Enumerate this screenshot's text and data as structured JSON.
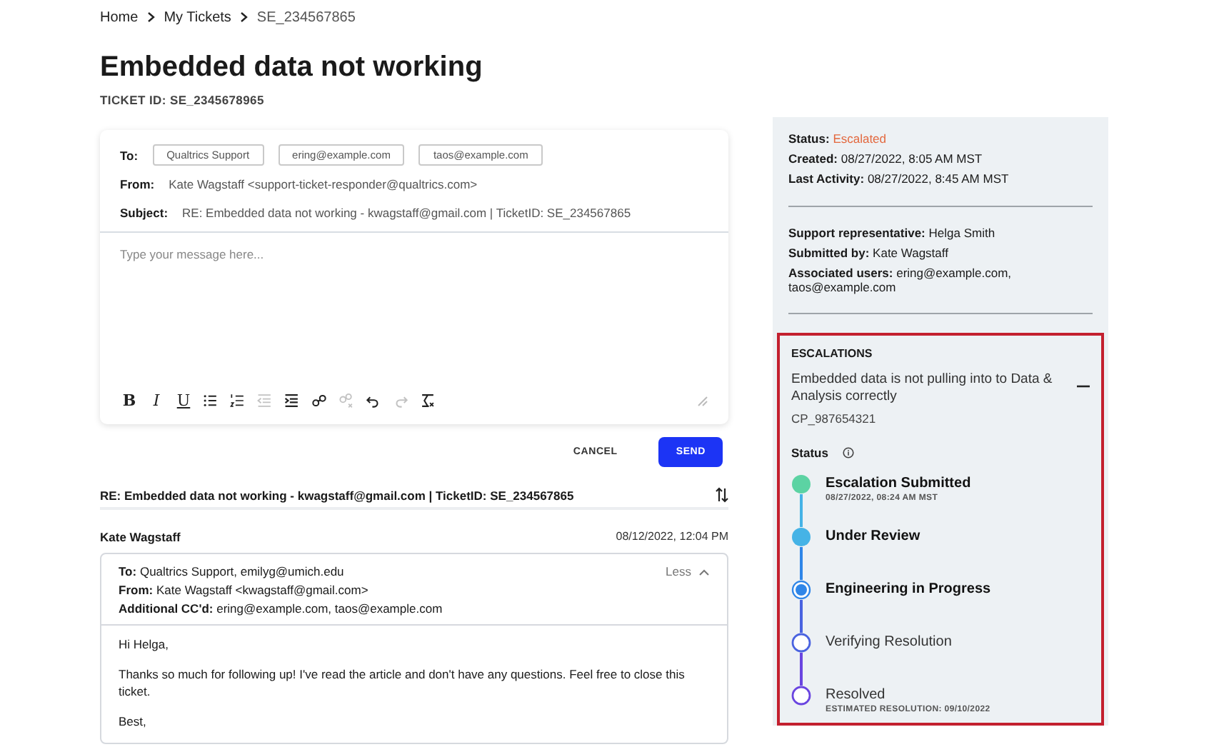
{
  "breadcrumb": [
    {
      "label": "Home",
      "kind": "link"
    },
    {
      "label": "My Tickets",
      "kind": "link"
    },
    {
      "label": "SE_234567865",
      "kind": "current"
    }
  ],
  "title": "Embedded data not working",
  "ticket_id": "TICKET ID: SE_2345678965",
  "compose": {
    "to_label": "To:",
    "recipients": [
      "Qualtrics Support",
      "ering@example.com",
      "taos@example.com"
    ],
    "from_label": "From:",
    "from": "Kate Wagstaff <support-ticket-responder@qualtrics.com>",
    "subject_label": "Subject:",
    "subject": "RE: Embedded data not working - kwagstaff@gmail.com | TicketID: SE_234567865",
    "placeholder": "Type your message here...",
    "tools": [
      {
        "kind": "bold",
        "glyph": "B",
        "disabled": false
      },
      {
        "kind": "italic",
        "glyph": "I",
        "disabled": false
      },
      {
        "kind": "underline",
        "glyph": "U",
        "disabled": false
      },
      {
        "kind": "bullets",
        "disabled": false
      },
      {
        "kind": "numbers",
        "disabled": false
      },
      {
        "kind": "outdent",
        "disabled": true
      },
      {
        "kind": "indent",
        "disabled": false
      },
      {
        "kind": "link",
        "disabled": false
      },
      {
        "kind": "unlink",
        "disabled": true
      },
      {
        "kind": "undo",
        "disabled": false
      },
      {
        "kind": "redo",
        "disabled": true
      },
      {
        "kind": "clear",
        "disabled": false
      }
    ]
  },
  "actions": [
    {
      "label": "CANCEL",
      "kind": "secondary"
    },
    {
      "label": "SEND",
      "kind": "primary"
    }
  ],
  "thread": {
    "subject": "RE: Embedded data not working - kwagstaff@gmail.com | TicketID: SE_234567865",
    "message": {
      "author": "Kate Wagstaff",
      "date": "08/12/2022, 12:04 PM",
      "toggle": "Less",
      "expanded": true,
      "headers": [
        {
          "label": "To:",
          "value": "Qualtrics Support, emilyg@umich.edu"
        },
        {
          "label": "From:",
          "value": "Kate Wagstaff <kwagstaff@gmail.com>"
        },
        {
          "label": "Additional CC'd:",
          "value": "ering@example.com, taos@example.com"
        }
      ],
      "body": [
        "Hi Helga,",
        "Thanks so much for following up! I've read the article and don't have any questions. Feel free to close this ticket.",
        "Best,"
      ]
    }
  },
  "details": {
    "groups": [
      [
        {
          "label": "Status:",
          "value": "Escalated",
          "kind": "alert"
        },
        {
          "label": "Created:",
          "value": "08/27/2022, 8:05 AM MST",
          "kind": "plain"
        },
        {
          "label": "Last Activity:",
          "value": "08/27/2022, 8:45 AM MST",
          "kind": "plain"
        }
      ],
      [
        {
          "label": "Support representative:",
          "value": "Helga Smith",
          "kind": "plain"
        },
        {
          "label": "Submitted by:",
          "value": "Kate Wagstaff",
          "kind": "plain"
        },
        {
          "label": "Associated users:",
          "value": "ering@example.com, taos@example.com",
          "kind": "plain"
        }
      ]
    ]
  },
  "escalations": {
    "heading": "ESCALATIONS",
    "highlighted": true,
    "item": {
      "title": "Embedded data is not pulling into to Data & Analysis correctly",
      "id": "CP_987654321",
      "expanded": true,
      "status_label": "Status",
      "steps": [
        {
          "label": "Escalation Submitted",
          "kind": "done",
          "color": "#5cd3a3",
          "note": "08/27/2022, 08:24 AM MST"
        },
        {
          "label": "Under Review",
          "kind": "done",
          "color": "#45b3e6"
        },
        {
          "label": "Engineering in Progress",
          "kind": "current",
          "color": "#2f86e8"
        },
        {
          "label": "Verifying Resolution",
          "kind": "pending",
          "color": "#4a63e0"
        },
        {
          "label": "Resolved",
          "kind": "pending",
          "color": "#6a45e0",
          "note": "ESTIMATED RESOLUTION: 09/10/2022"
        }
      ]
    }
  }
}
